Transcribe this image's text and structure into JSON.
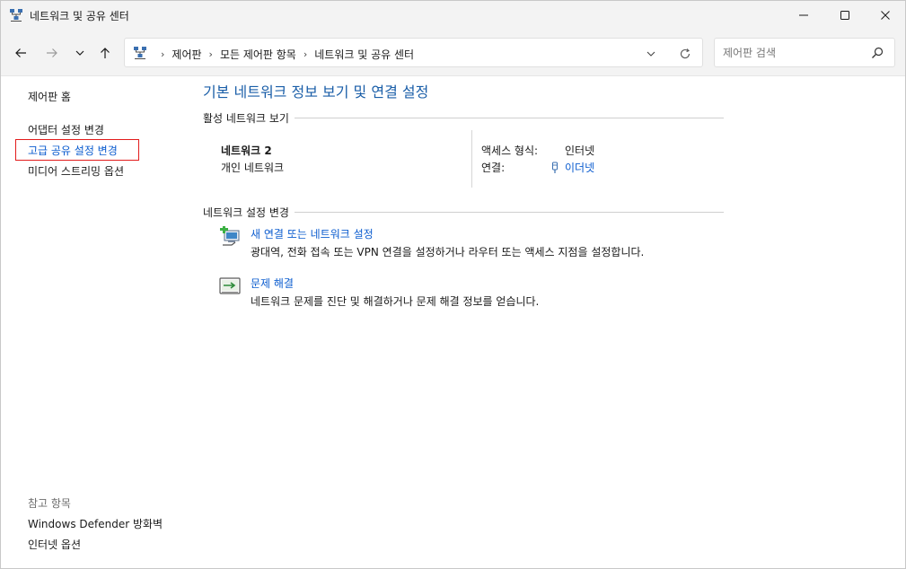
{
  "window": {
    "title": "네트워크 및 공유 센터",
    "app_icon": "network-sharing-icon",
    "controls": {
      "minimize": "minimize-icon",
      "maximize": "maximize-icon",
      "close": "close-icon"
    }
  },
  "navigation": {
    "back_icon": "arrow-left-icon",
    "forward_icon": "arrow-right-icon",
    "recent_icon": "chevron-down-icon",
    "up_icon": "arrow-up-icon",
    "breadcrumbs": [
      "제어판",
      "모든 제어판 항목",
      "네트워크 및 공유 센터"
    ],
    "search": {
      "placeholder": "제어판 검색",
      "value": ""
    }
  },
  "sidebar": {
    "home": "제어판 홈",
    "links": [
      {
        "label": "어댑터 설정 변경"
      },
      {
        "label": "고급 공유 설정 변경",
        "highlighted": true
      },
      {
        "label": "미디어 스트리밍 옵션"
      }
    ],
    "see_also_title": "참고 항목",
    "see_also": [
      {
        "label": "Windows Defender 방화벽"
      },
      {
        "label": "인터넷 옵션"
      }
    ]
  },
  "main": {
    "title": "기본 네트워크 정보 보기 및 연결 설정",
    "active_section": "활성 네트워크 보기",
    "network": {
      "name": "네트워크 2",
      "type": "개인 네트워크",
      "access_label": "액세스 형식:",
      "access_value": "인터넷",
      "connection_label": "연결:",
      "connection_value": "이더넷"
    },
    "change_section": "네트워크 설정 변경",
    "tasks": [
      {
        "icon": "new-connection-icon",
        "label": "새 연결 또는 네트워크 설정",
        "description": "광대역, 전화 접속 또는 VPN 연결을 설정하거나 라우터 또는 액세스 지점을 설정합니다."
      },
      {
        "icon": "troubleshoot-icon",
        "label": "문제 해결",
        "description": "네트워크 문제를 진단 및 해결하거나 문제 해결 정보를 얻습니다."
      }
    ]
  },
  "colors": {
    "link": "#0b5ccf",
    "title": "#1a5ea8",
    "highlight_border": "#e21b1b",
    "chrome": "#f3f3f3"
  }
}
